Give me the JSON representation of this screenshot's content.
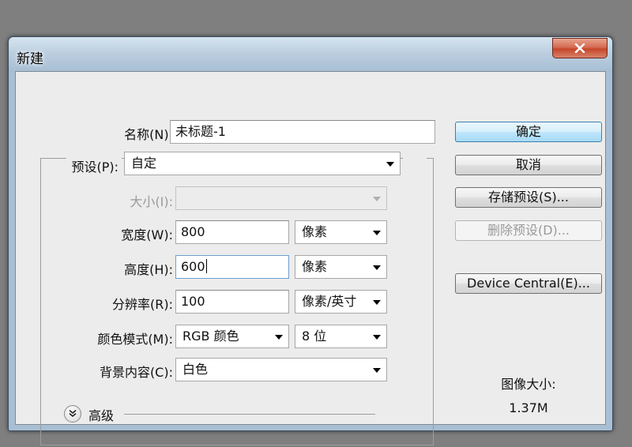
{
  "dialog": {
    "title": "新建"
  },
  "form": {
    "name_label": "名称(N):",
    "name_value": "未标题-1",
    "preset_label": "预设(P):",
    "preset_value": "自定",
    "size_label": "大小(I):",
    "size_value": "",
    "width_label": "宽度(W):",
    "width_value": "800",
    "width_unit": "像素",
    "height_label": "高度(H):",
    "height_value": "600",
    "height_unit": "像素",
    "resolution_label": "分辨率(R):",
    "resolution_value": "100",
    "resolution_unit": "像素/英寸",
    "color_mode_label": "颜色模式(M):",
    "color_mode_value": "RGB 颜色",
    "bit_depth_value": "8 位",
    "background_label": "背景内容(C):",
    "background_value": "白色",
    "advanced_label": "高级"
  },
  "buttons": {
    "ok": "确定",
    "cancel": "取消",
    "save_preset": "存储预设(S)...",
    "delete_preset": "删除预设(D)...",
    "device_central": "Device Central(E)..."
  },
  "image_size": {
    "label": "图像大小:",
    "value": "1.37M"
  }
}
